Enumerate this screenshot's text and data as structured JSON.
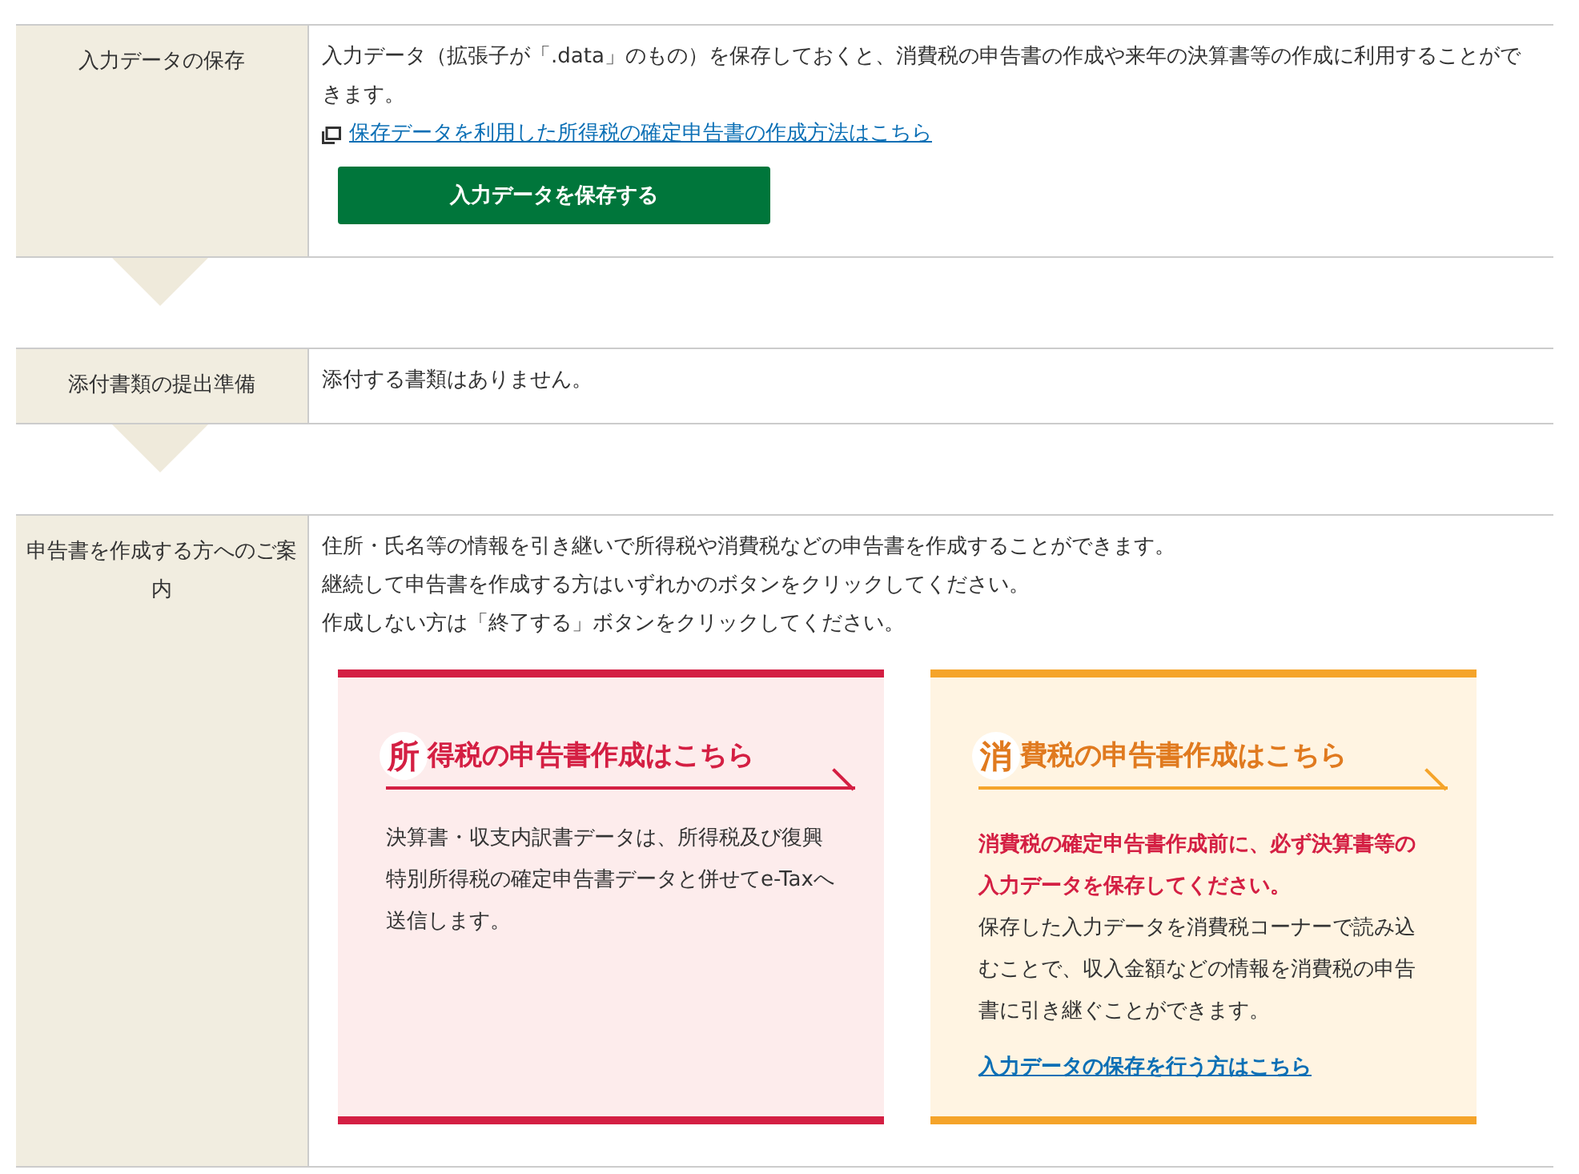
{
  "sections": [
    {
      "kind": "save",
      "label": "入力データの保存",
      "text": "入力データ（拡張子が「.data」のもの）を保存しておくと、消費税の申告書の作成や来年の決算書等の作成に利用することができます。",
      "link": "保存データを利用した所得税の確定申告書の作成方法はこちら",
      "button": "入力データを保存する"
    },
    {
      "kind": "plain",
      "label": "添付書類の提出準備",
      "text": "添付する書類はありません。"
    },
    {
      "kind": "guide",
      "label": "申告書を作成する方へのご案内",
      "lines": [
        "住所・氏名等の情報を引き継いで所得税や消費税などの申告書を作成することができます。",
        "継続して申告書を作成する方はいずれかのボタンをクリックしてください。",
        "作成しない方は「終了する」ボタンをクリックしてください。"
      ],
      "cards": [
        {
          "kind": "income",
          "initial": "所",
          "title": "得税の申告書作成はこちら",
          "body": "決算書・収支内訳書データは、所得税及び復興特別所得税の確定申告書データと併せてe-Taxへ送信します。"
        },
        {
          "kind": "consumption",
          "initial": "消",
          "title": "費税の申告書作成はこちら",
          "warning": "消費税の確定申告書作成前に、必ず決算書等の入力データを保存してください。",
          "body": "保存した入力データを消費税コーナーで読み込むことで、収入金額などの情報を消費税の申告書に引き継ぐことができます。",
          "link": "入力データの保存を行う方はこちら"
        }
      ]
    }
  ]
}
